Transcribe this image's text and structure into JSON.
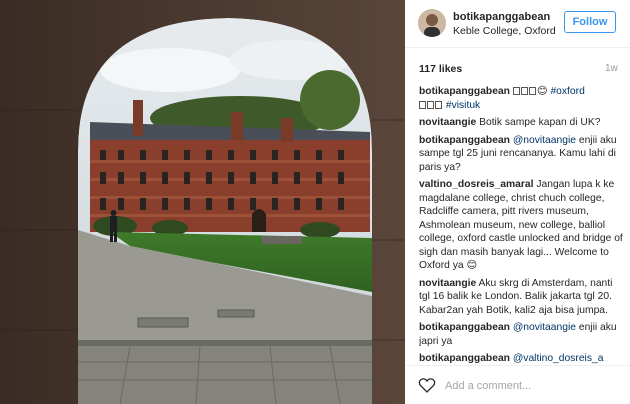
{
  "post": {
    "username": "botikapanggabean",
    "location": "Keble College, Oxford",
    "follow_label": "Follow",
    "likes": "117 likes",
    "time": "1w",
    "add_comment_placeholder": "Add a comment..."
  },
  "caption": {
    "author": "botikapanggabean",
    "emoji_desc": "⬚⬚⬚😊",
    "tag1": "#oxford",
    "tag2": "#visituk",
    "emoji2_desc": "⬚⬚⬚"
  },
  "comments": [
    {
      "author": "novitaangie",
      "text": "Botik sampe kapan di UK?"
    },
    {
      "author": "botikapanggabean",
      "mention": "@novitaangie",
      "text": "enjii aku sampe tgl 25 juni rencananya. Kamu lahi di paris ya?"
    },
    {
      "author": "valtino_dosreis_amaral",
      "text": "Jangan lupa k ke magdalane college, christ chuch college, Radcliffe camera, pitt rivers museum, Ashmolean museum, new college, balliol college, oxford castle unlocked and bridge of sigh dan masih banyak lagi... Welcome to Oxford ya 😊"
    },
    {
      "author": "novitaangie",
      "text": "Aku skrg di Amsterdam, nanti tgl 16 balik ke London. Balik jakarta tgl 20. Kabar2an yah Botik, kali2 aja bisa jumpa."
    },
    {
      "author": "botikapanggabean",
      "mention": "@novitaangie",
      "text": "enjii aku japri ya"
    },
    {
      "author": "botikapanggabean",
      "mention": "@valtino_dosreis_a",
      "text": ""
    }
  ],
  "colors": {
    "follow_blue": "#3897f0",
    "link_blue": "#003569",
    "text": "#262626",
    "muted": "#999999"
  }
}
